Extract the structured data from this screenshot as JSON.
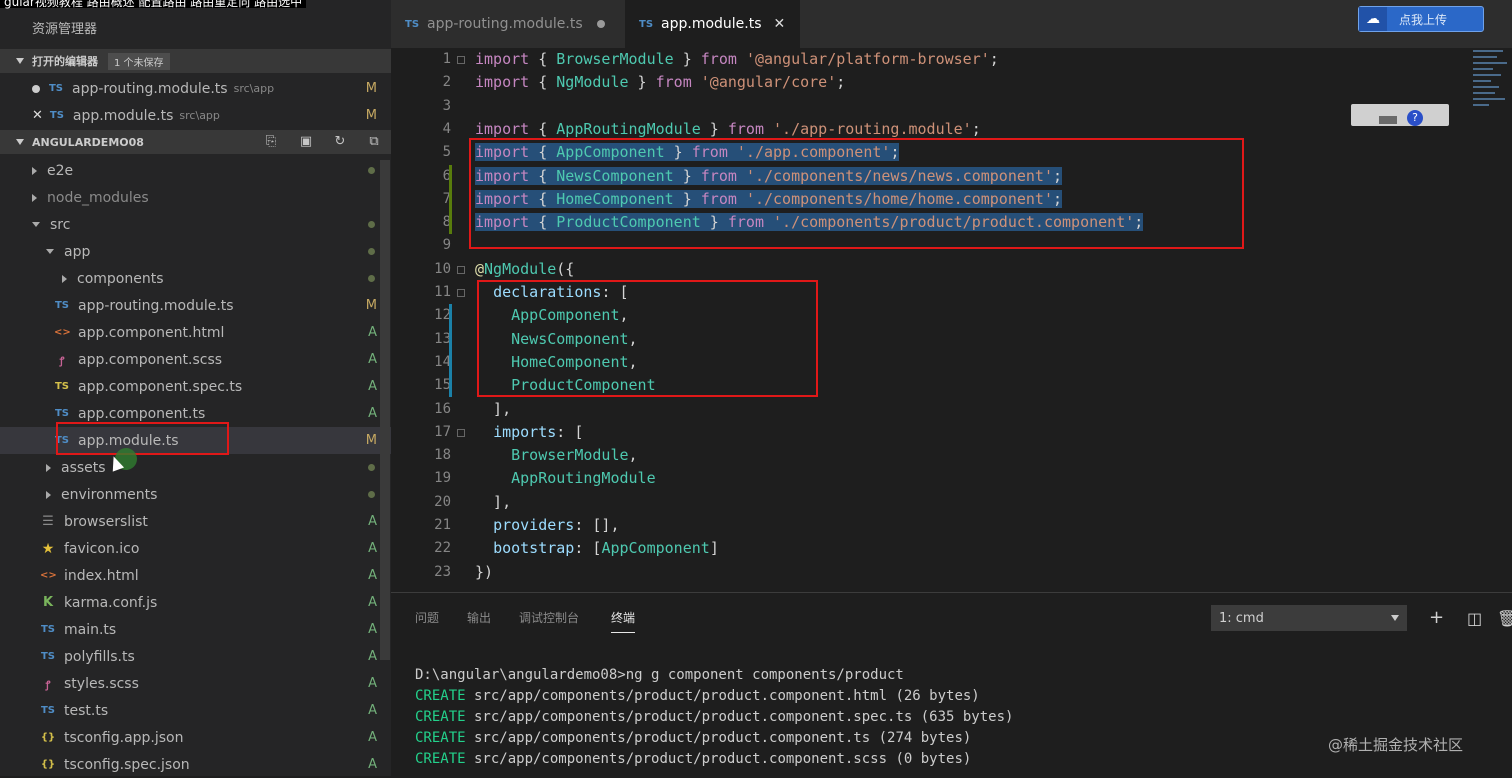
{
  "caption": "gular视频教程 路由概述 配置路由 路由重定向 路由选中",
  "sidebar": {
    "title": "资源管理器",
    "open_editors": {
      "label": "打开的编辑器",
      "badge": "1 个未保存"
    },
    "open_files": [
      {
        "name": "app-routing.module.ts",
        "path": "src\\app",
        "status": "M"
      },
      {
        "name": "app.module.ts",
        "path": "src\\app",
        "status": "M"
      }
    ],
    "project": {
      "label": "ANGULARDEMO08"
    },
    "tree": [
      {
        "name": "e2e",
        "type": "folder",
        "status": ""
      },
      {
        "name": "node_modules",
        "type": "folder",
        "status": ""
      },
      {
        "name": "src",
        "type": "folder-open",
        "status": ""
      },
      {
        "name": "app",
        "type": "folder-open",
        "status": ""
      },
      {
        "name": "components",
        "type": "folder",
        "status": ""
      },
      {
        "name": "app-routing.module.ts",
        "type": "ts",
        "status": "M"
      },
      {
        "name": "app.component.html",
        "type": "html",
        "status": "A"
      },
      {
        "name": "app.component.scss",
        "type": "scss",
        "status": "A"
      },
      {
        "name": "app.component.spec.ts",
        "type": "tsy",
        "status": "A"
      },
      {
        "name": "app.component.ts",
        "type": "ts",
        "status": "A"
      },
      {
        "name": "app.module.ts",
        "type": "ts",
        "status": "M"
      },
      {
        "name": "assets",
        "type": "folder",
        "status": ""
      },
      {
        "name": "environments",
        "type": "folder",
        "status": ""
      },
      {
        "name": "browserslist",
        "type": "list",
        "status": "A"
      },
      {
        "name": "favicon.ico",
        "type": "star",
        "status": "A"
      },
      {
        "name": "index.html",
        "type": "html",
        "status": "A"
      },
      {
        "name": "karma.conf.js",
        "type": "k",
        "status": "A"
      },
      {
        "name": "main.ts",
        "type": "ts",
        "status": "A"
      },
      {
        "name": "polyfills.ts",
        "type": "ts",
        "status": "A"
      },
      {
        "name": "styles.scss",
        "type": "scss",
        "status": "A"
      },
      {
        "name": "test.ts",
        "type": "ts",
        "status": "A"
      },
      {
        "name": "tsconfig.app.json",
        "type": "json",
        "status": "A"
      },
      {
        "name": "tsconfig.spec.json",
        "type": "json",
        "status": "A"
      }
    ]
  },
  "tabs": [
    {
      "label": "app-routing.module.ts",
      "icon": "TS"
    },
    {
      "label": "app.module.ts",
      "icon": "TS"
    }
  ],
  "upload_button": "点我上传",
  "editor": {
    "line_numbers": [
      "1",
      "2",
      "3",
      "4",
      "5",
      "6",
      "7",
      "8",
      "9",
      "10",
      "11",
      "12",
      "13",
      "14",
      "15",
      "16",
      "17",
      "18",
      "19",
      "20",
      "21",
      "22",
      "23"
    ],
    "lines": [
      "import { BrowserModule } from '@angular/platform-browser';",
      "import { NgModule } from '@angular/core';",
      "",
      "import { AppRoutingModule } from './app-routing.module';",
      "import { AppComponent } from './app.component';",
      "import { NewsComponent } from './components/news/news.component';",
      "import { HomeComponent } from './components/home/home.component';",
      "import { ProductComponent } from './components/product/product.component';",
      "",
      "@NgModule({",
      "  declarations: [",
      "    AppComponent,",
      "    NewsComponent,",
      "    HomeComponent,",
      "    ProductComponent",
      "  ],",
      "  imports: [",
      "    BrowserModule,",
      "    AppRoutingModule",
      "  ],",
      "  providers: [],",
      "  bootstrap: [AppComponent]",
      "})"
    ]
  },
  "panel": {
    "tabs": [
      "问题",
      "输出",
      "调试控制台",
      "终端"
    ],
    "terminal_select": "1: cmd",
    "terminal_lines": [
      {
        "prefix": "",
        "text": "D:\\angular\\angulardemo08>ng g component components/product"
      },
      {
        "prefix": "CREATE",
        "text": " src/app/components/product/product.component.html (26 bytes)"
      },
      {
        "prefix": "CREATE",
        "text": " src/app/components/product/product.component.spec.ts (635 bytes)"
      },
      {
        "prefix": "CREATE",
        "text": " src/app/components/product/product.component.ts (274 bytes)"
      },
      {
        "prefix": "CREATE",
        "text": " src/app/components/product/product.component.scss (0 bytes)"
      }
    ]
  },
  "watermark": "@稀土掘金技术社区"
}
